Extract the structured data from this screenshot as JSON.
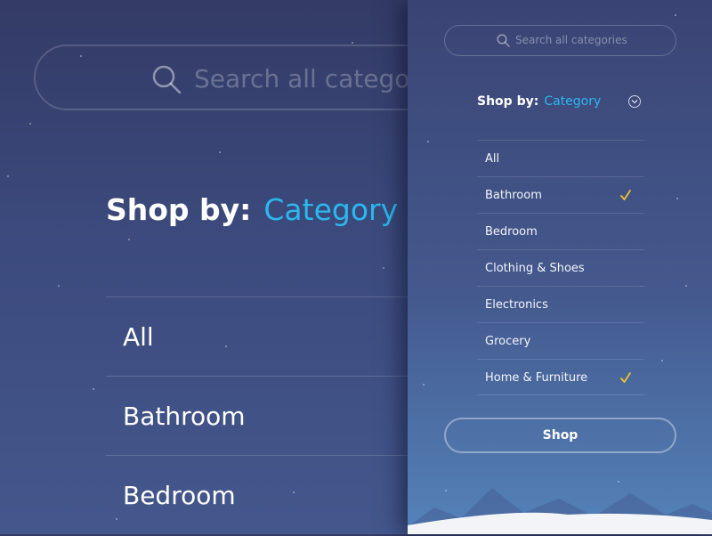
{
  "background": {
    "search_placeholder": "Search all categories",
    "search_icon": "search-icon",
    "shop_by_label": "Shop by:",
    "shop_by_value": "Category",
    "items": [
      "All",
      "Bathroom",
      "Bedroom"
    ]
  },
  "panel": {
    "search_placeholder": "Search all categories",
    "search_icon": "search-icon",
    "shop_by_label": "Shop by:",
    "shop_by_value": "Category",
    "dropdown_icon": "chevron-down-icon",
    "categories": [
      {
        "label": "All",
        "checked": false
      },
      {
        "label": "Bathroom",
        "checked": true
      },
      {
        "label": "Bedroom",
        "checked": false
      },
      {
        "label": "Clothing & Shoes",
        "checked": false
      },
      {
        "label": "Electronics",
        "checked": false
      },
      {
        "label": "Grocery",
        "checked": false
      },
      {
        "label": "Home & Furniture",
        "checked": true
      }
    ],
    "shop_button": "Shop"
  },
  "colors": {
    "accent": "#2bb8ef",
    "check": "#f2c230",
    "background_top": "#333b66",
    "panel_bottom": "#5483b9"
  }
}
